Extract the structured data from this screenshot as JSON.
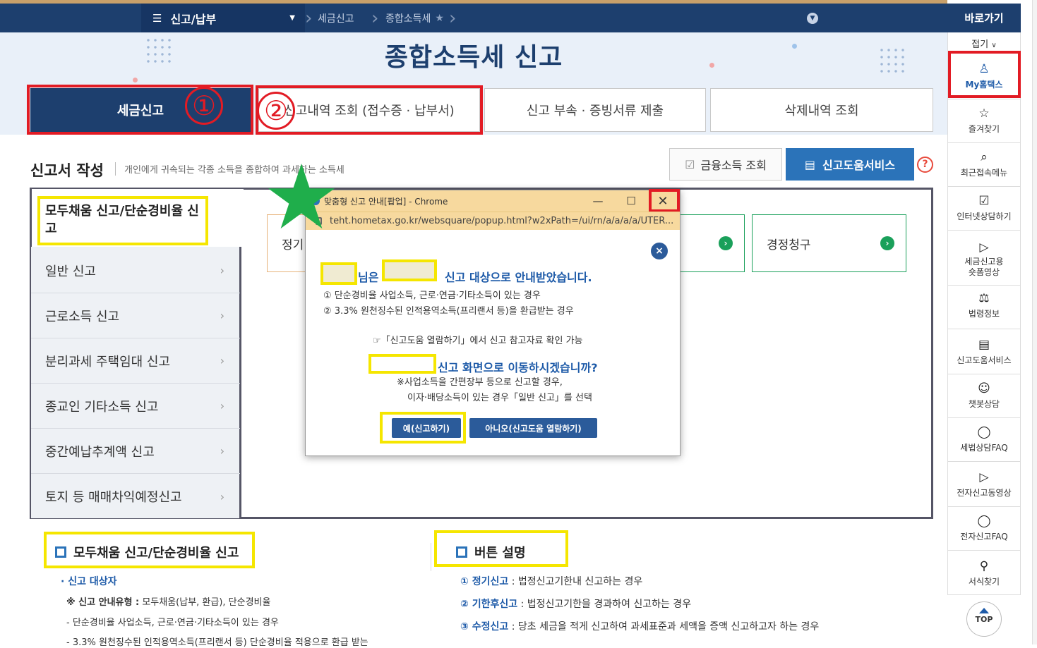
{
  "topnav": {
    "menu_label": "신고/납부",
    "crumbs": [
      "세금신고",
      "종합소득세"
    ],
    "quick_label": "바로가기"
  },
  "page": {
    "title": "종합소득세 신고",
    "tabs": [
      {
        "label": "세금신고",
        "active": true
      },
      {
        "label": "신고내역 조회 (접수증 · 납부서)"
      },
      {
        "label": "신고 부속 · 증빙서류 제출"
      },
      {
        "label": "삭제내역 조회"
      }
    ],
    "annotations": {
      "one": "①",
      "two": "②"
    }
  },
  "section": {
    "title": "신고서 작성",
    "desc": "개인에게 귀속되는 각종 소득을 종합하여 과세하는 소득세",
    "btn_fin": "금융소득 조회",
    "btn_help": "신고도움서비스",
    "help_q": "?"
  },
  "panel": {
    "head": "모두채움 신고/단순경비율 신고",
    "items": [
      "일반 신고",
      "근로소득 신고",
      "분리과세 주택임대 신고",
      "종교인 기타소득 신고",
      "중간예납추계액 신고",
      "토지 등 매매차익예정신고"
    ],
    "cards": [
      "정기",
      "경정청구"
    ]
  },
  "lower": {
    "left_title": "모두채움 신고/단순경비율 신고",
    "left_sub": "· 신고 대상자",
    "left_line1_bold": "※ 신고 안내유형 :",
    "left_line1": " 모두채움(납부, 환급), 단순경비율",
    "left_line2": "- 단순경비율 사업소득, 근로·연금·기타소득이 있는 경우",
    "left_line3": "- 3.3% 원천징수된 인적용역소득(프리랜서 등) 단순경비율 적용으로 환급 받는",
    "right_title": "버튼 설명",
    "right_items": [
      {
        "num": "① 정기신고",
        "text": " : 법정신고기한내 신고하는 경우"
      },
      {
        "num": "② 기한후신고",
        "text": " : 법정신고기한을 경과하여 신고하는 경우"
      },
      {
        "num": "③ 수정신고",
        "text": " : 당초 세금을 적게 신고하여 과세표준과 세액을 증액 신고하고자 하는 경우"
      }
    ]
  },
  "rail": {
    "fold": "접기",
    "items": [
      "My홈택스",
      "즐겨찾기",
      "최근접속메뉴",
      "인터넷상담하기",
      "세금신고용\n숏폼영상",
      "법령정보",
      "신고도움서비스",
      "챗봇상담",
      "세법상담FAQ",
      "전자신고동영상",
      "전자신고FAQ",
      "서식찾기"
    ],
    "top": "TOP"
  },
  "popup": {
    "window_title": "맞춤형 신고 안내[팝업] - Chrome",
    "url": "teht.hometax.go.kr/websquare/popup.html?w2xPath=/ui/rn/a/a/a/a/UTER...",
    "line_head_mid": "님은",
    "line_head_end": "신고 대상으로 안내받았습니다.",
    "case1": "① 단순경비율 사업소득, 근로·연금·기타소득이 있는 경우",
    "case2": "② 3.3% 원천징수된 인적용역소득(프리랜서 등)을 환급받는 경우",
    "hint": "☞「신고도움 열람하기」에서 신고 참고자료 확인 가능",
    "question": "신고 화면으로 이동하시겠습니까?",
    "note1": "※사업소득을 간편장부 등으로 신고할 경우,",
    "note2": "이자·배당소득이 있는 경우「일반 신고」를 선택",
    "yes": "예(신고하기)",
    "no": "아니오(신고도움 열람하기)"
  },
  "colors": {
    "navy": "#1d3f6e",
    "blue": "#2b73b9",
    "red_annot": "#e21b24",
    "yellow_annot": "#f5e600",
    "star": "#1fae4b"
  }
}
